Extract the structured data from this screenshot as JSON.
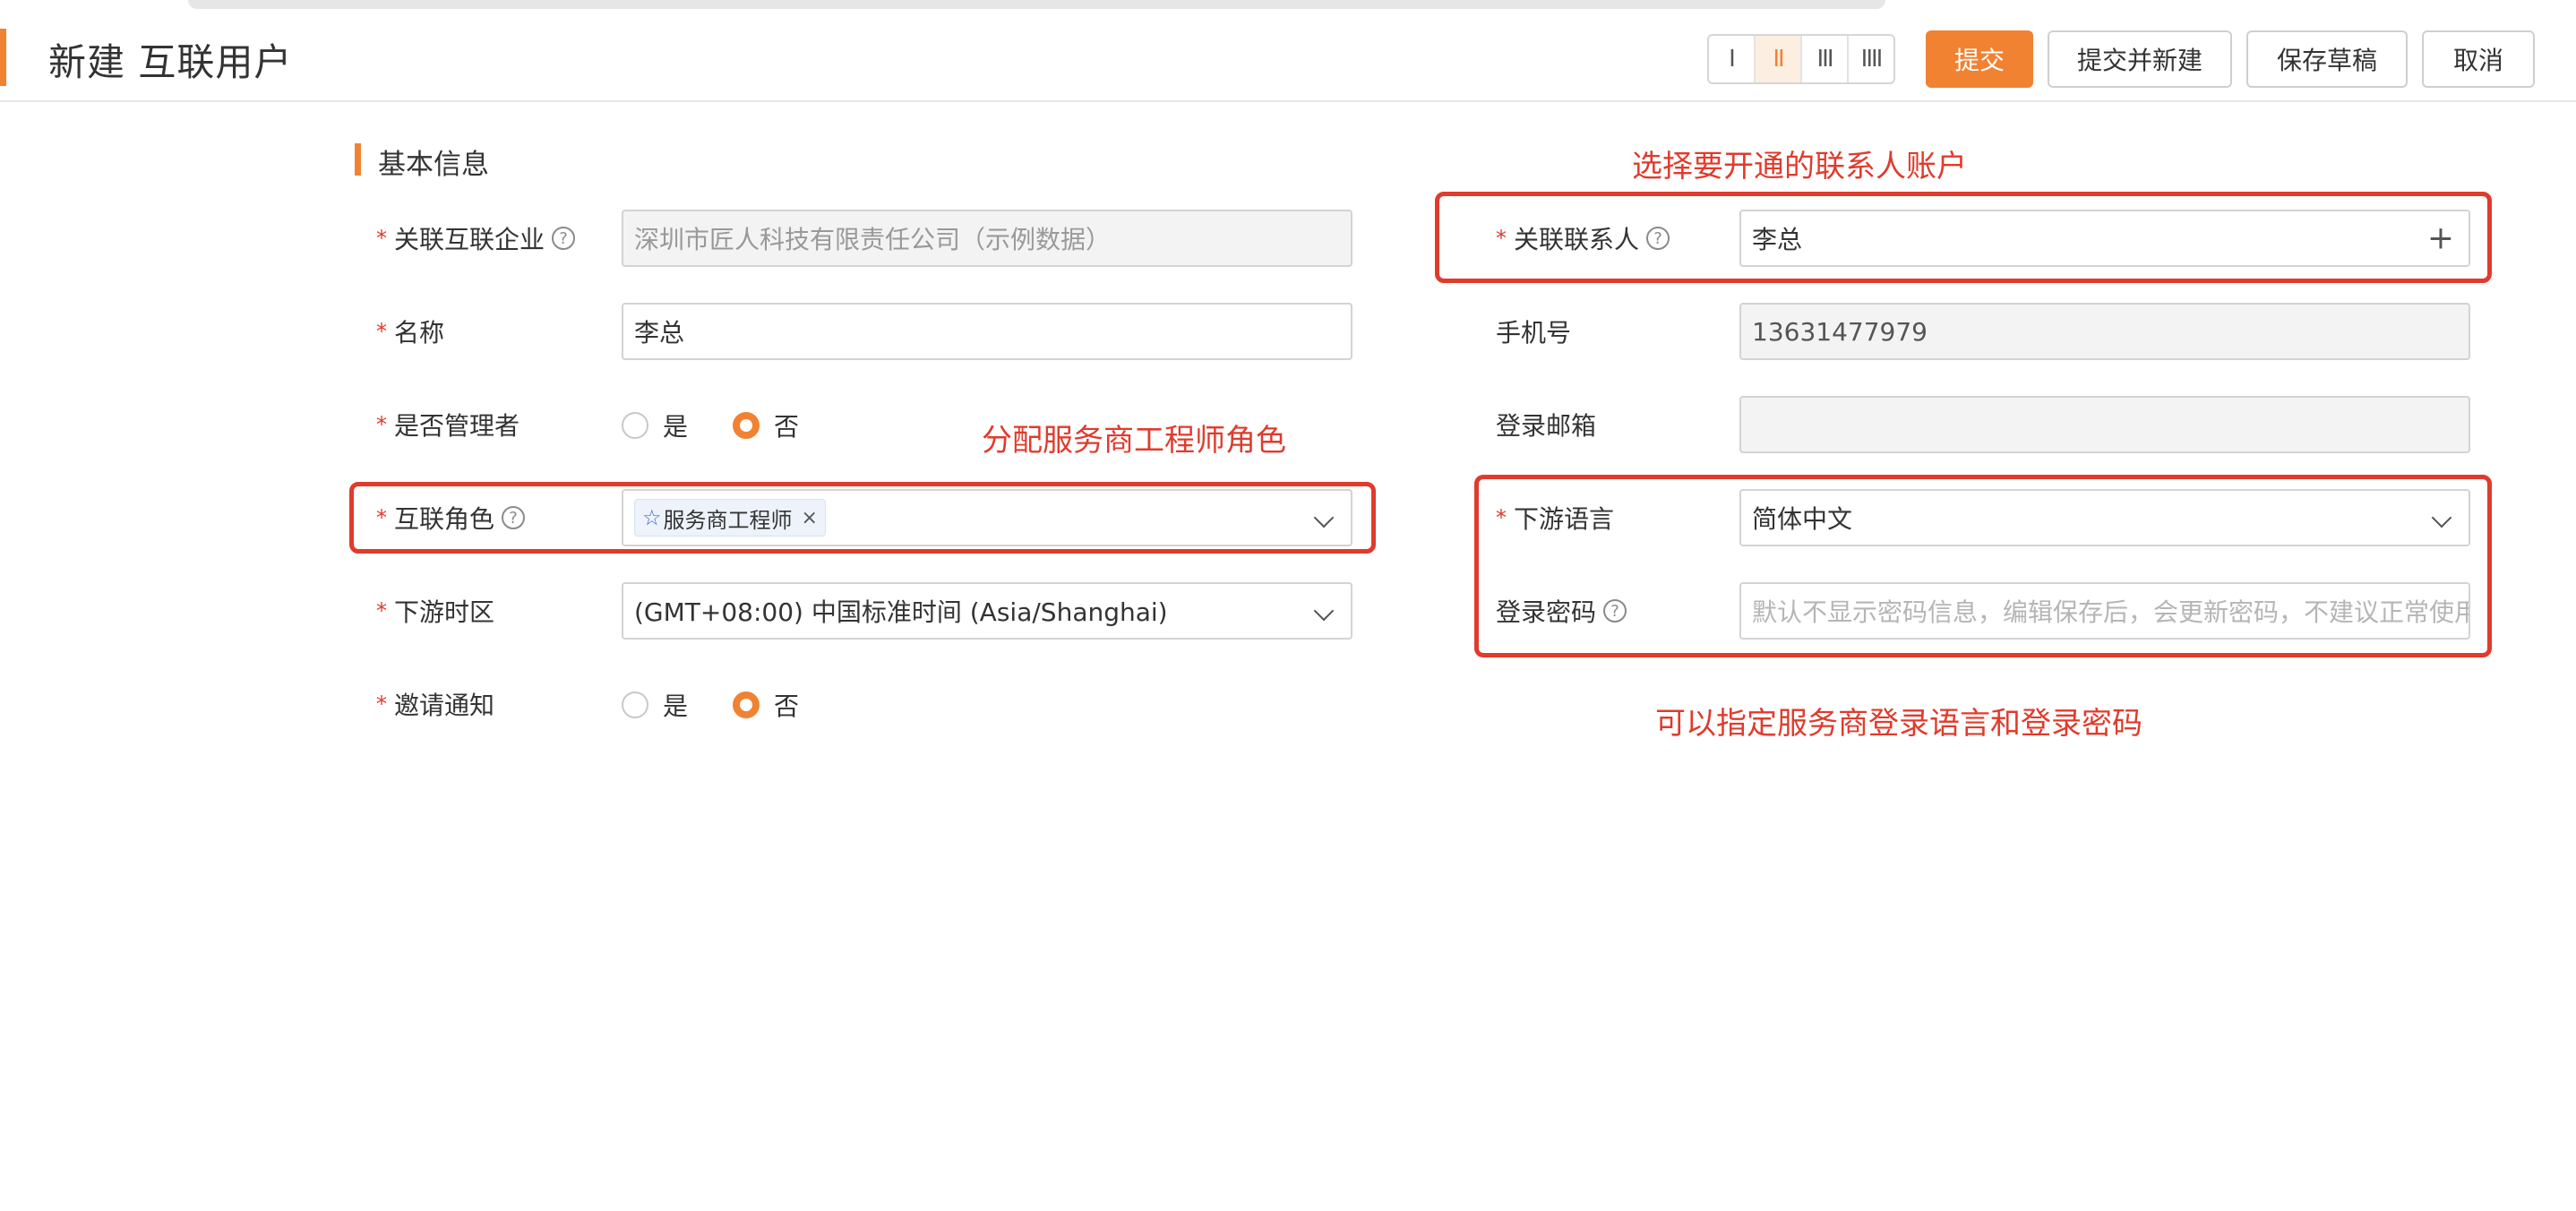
{
  "header": {
    "title": "新建 互联用户",
    "layout_options": [
      "Ⅰ",
      "ⅠⅠ",
      "ⅠⅠⅠ",
      "ⅠⅠⅠⅠ"
    ],
    "layout_active_index": 1,
    "buttons": {
      "submit": "提交",
      "submit_new": "提交并新建",
      "save_draft": "保存草稿",
      "cancel": "取消"
    }
  },
  "section": {
    "title": "基本信息"
  },
  "form_left": {
    "company": {
      "label": "关联互联企业",
      "value": "深圳市匠人科技有限责任公司（示例数据）",
      "required": true
    },
    "name": {
      "label": "名称",
      "value": "李总",
      "required": true
    },
    "is_admin": {
      "label": "是否管理者",
      "options": [
        "是",
        "否"
      ],
      "selected": "否",
      "required": true
    },
    "role": {
      "label": "互联角色",
      "tag": "服务商工程师",
      "required": true
    },
    "timezone": {
      "label": "下游时区",
      "value": "(GMT+08:00) 中国标准时间 (Asia/Shanghai)",
      "required": true
    },
    "invite": {
      "label": "邀请通知",
      "options": [
        "是",
        "否"
      ],
      "selected": "否",
      "required": true
    }
  },
  "form_right": {
    "contact": {
      "label": "关联联系人",
      "value": "李总",
      "required": true
    },
    "phone": {
      "label": "手机号",
      "value": "13631477979"
    },
    "email": {
      "label": "登录邮箱",
      "value": ""
    },
    "language": {
      "label": "下游语言",
      "value": "简体中文",
      "required": true
    },
    "password": {
      "label": "登录密码",
      "placeholder": "默认不显示密码信息，编辑保存后，会更新密码，不建议正常使用"
    }
  },
  "annotations": {
    "contact": "选择要开通的联系人账户",
    "role": "分配服务商工程师角色",
    "language_password": "可以指定服务商登录语言和登录密码"
  },
  "colors": {
    "accent": "#f08232",
    "annotation": "#e03b2c",
    "required": "#e03b2c"
  }
}
